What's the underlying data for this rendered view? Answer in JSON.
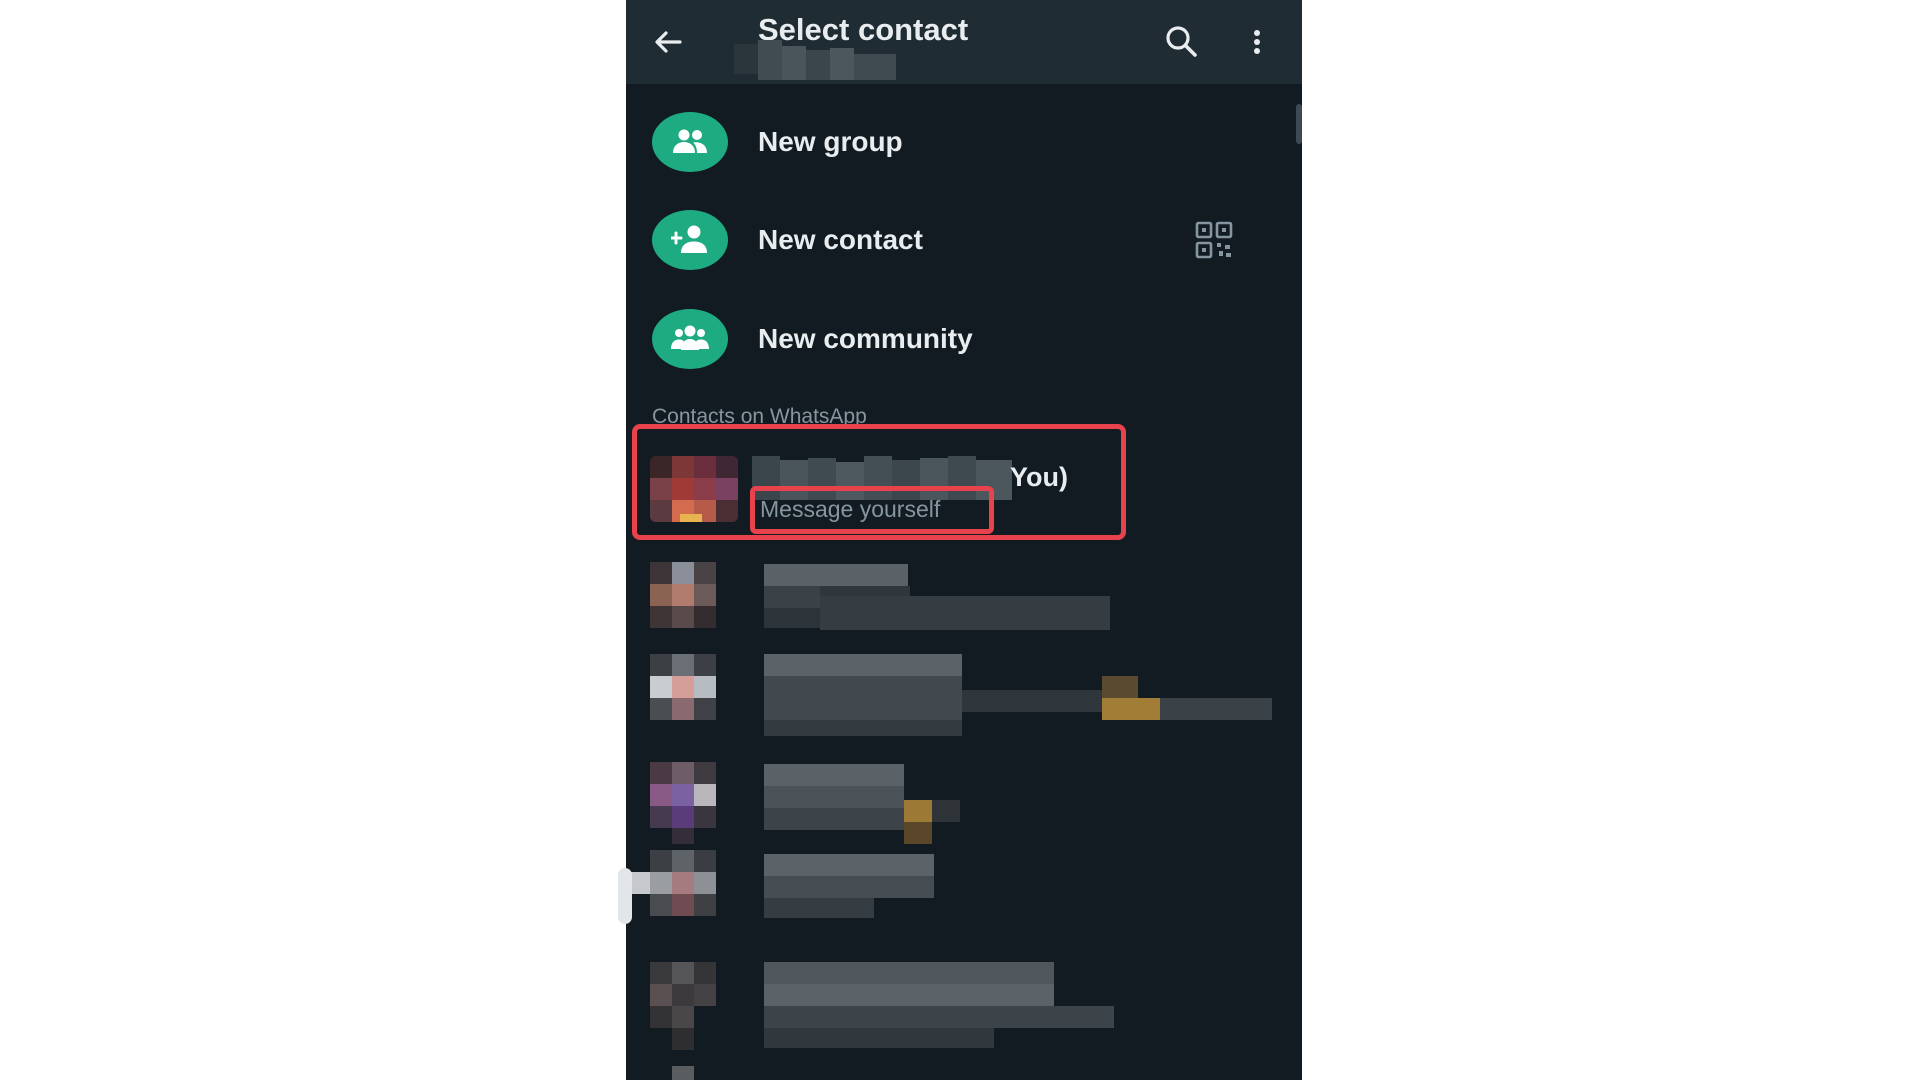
{
  "appbar": {
    "title": "Select contact",
    "back_icon": "arrow-left-icon",
    "search_icon": "search-icon",
    "menu_icon": "more-vertical-icon"
  },
  "actions": [
    {
      "label": "New group",
      "icon": "group-icon"
    },
    {
      "label": "New contact",
      "icon": "add-person-icon",
      "trailing_icon": "qr-code-icon"
    },
    {
      "label": "New community",
      "icon": "community-icon"
    }
  ],
  "section_header": "Contacts on WhatsApp",
  "self_contact": {
    "name_suffix": "You)",
    "status": "Message yourself"
  },
  "colors": {
    "background": "#111b21",
    "appbar": "#1f2c34",
    "accent": "#1eab82",
    "primary_text": "#e9edef",
    "secondary_text": "#8696a0",
    "highlight": "#e8424d"
  }
}
